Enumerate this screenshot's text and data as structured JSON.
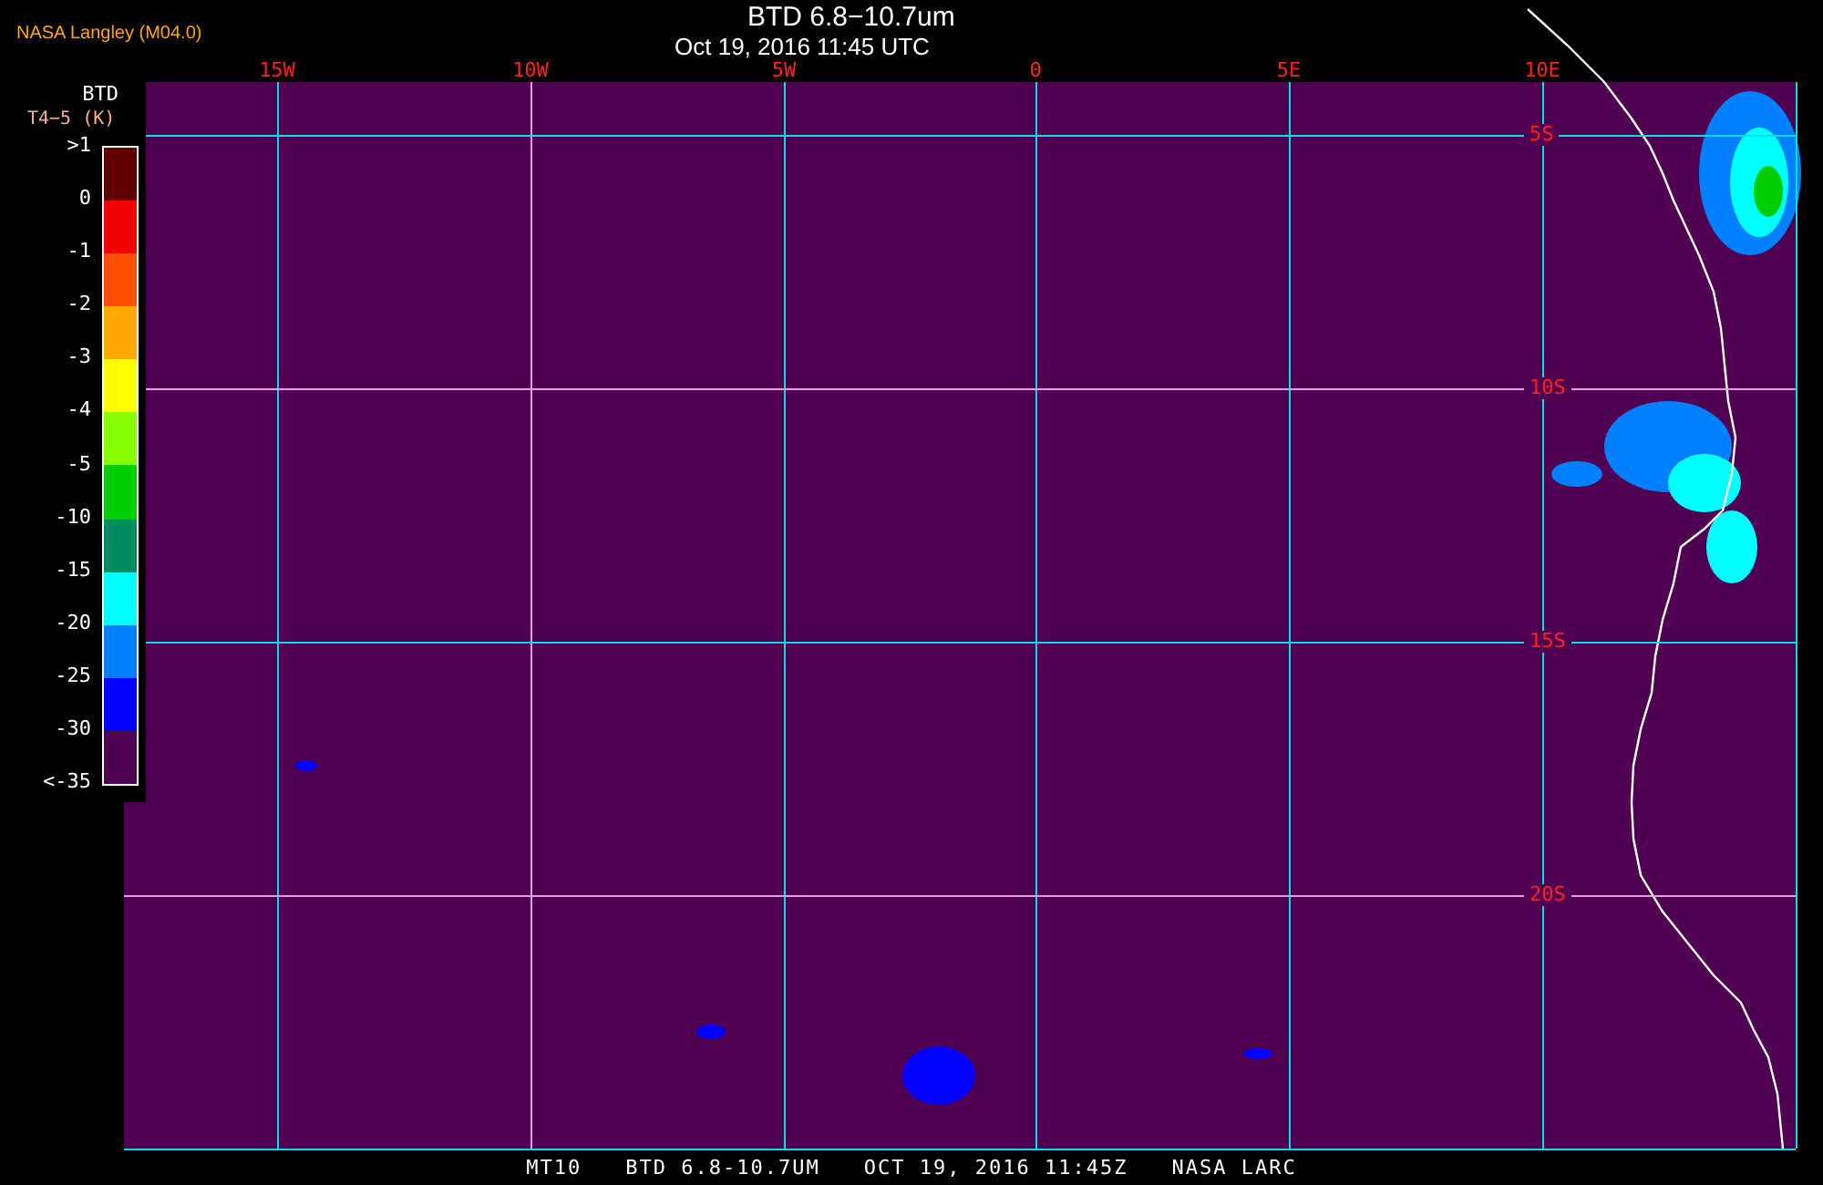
{
  "header": {
    "producer": "NASA Langley (M04.0)",
    "title": "BTD 6.8−10.7um",
    "timestamp": "Oct 19, 2016 11:45 UTC"
  },
  "legend": {
    "title": "BTD",
    "units": "T4−5 (K)",
    "labels": [
      ">1",
      "0",
      "-1",
      "-2",
      "-3",
      "-4",
      "-5",
      "-10",
      "-15",
      "-20",
      "-25",
      "-30",
      "<-35"
    ],
    "bins": [
      {
        "color": "#600000"
      },
      {
        "color": "#f00000"
      },
      {
        "color": "#ff5000"
      },
      {
        "color": "#ffa800"
      },
      {
        "color": "#ffff00"
      },
      {
        "color": "#88ff00"
      },
      {
        "color": "#00cc00"
      },
      {
        "color": "#008c60"
      },
      {
        "color": "#00ffff"
      },
      {
        "color": "#0080ff"
      },
      {
        "color": "#0000ff"
      },
      {
        "color": "#500050"
      }
    ]
  },
  "map": {
    "longitude_labels": [
      "15W",
      "10W",
      "5W",
      "0",
      "5E",
      "10E"
    ],
    "latitude_labels": [
      "5S",
      "10S",
      "15S",
      "20S"
    ]
  },
  "footer": [
    "MT10",
    "BTD 6.8-10.7UM",
    "OCT 19, 2016 11:45Z",
    "NASA LARC"
  ]
}
